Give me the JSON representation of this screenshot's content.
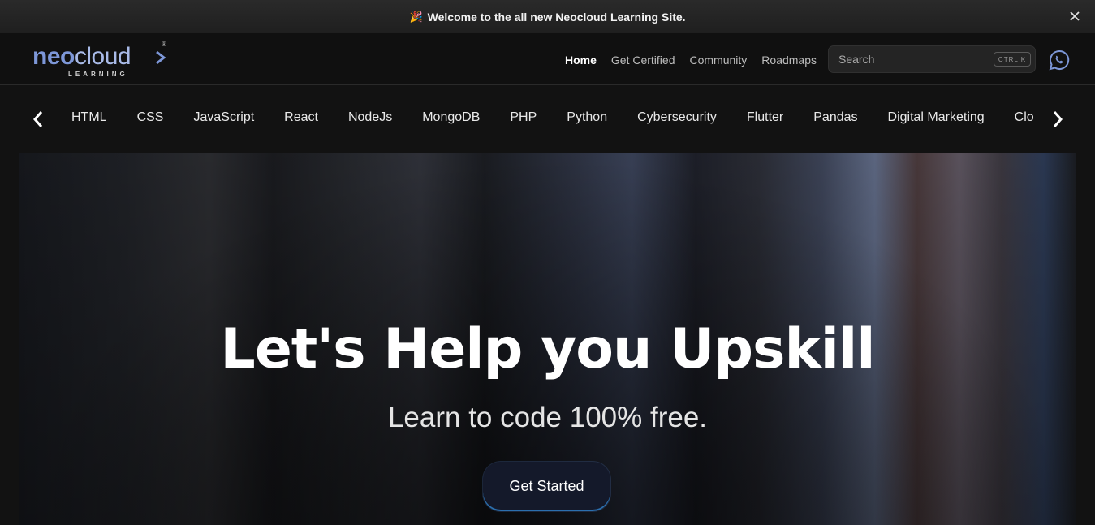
{
  "announcement": {
    "text": "Welcome to the all new Neocloud Learning Site.",
    "emoji": "🎉"
  },
  "brand": {
    "name_part1": "neo",
    "name_part2": "cloud",
    "tagline": "LEARNING",
    "registered_mark": "®",
    "primary_color": "#7d97d8"
  },
  "nav": {
    "items": [
      "Home",
      "Get Certified",
      "Community",
      "Roadmaps"
    ],
    "active": "Home"
  },
  "search": {
    "placeholder": "Search",
    "shortcut": "CTRL K"
  },
  "topics": [
    "HTML",
    "CSS",
    "JavaScript",
    "React",
    "NodeJs",
    "MongoDB",
    "PHP",
    "Python",
    "Cybersecurity",
    "Flutter",
    "Pandas",
    "Digital Marketing",
    "Clo"
  ],
  "hero": {
    "title": "Let's Help you Upskill",
    "subtitle": "Learn to code 100% free.",
    "cta": "Get Started"
  },
  "icons": {
    "close": "close-icon",
    "whatsapp": "whatsapp-icon",
    "prev": "chevron-left-icon",
    "next": "chevron-right-icon"
  }
}
